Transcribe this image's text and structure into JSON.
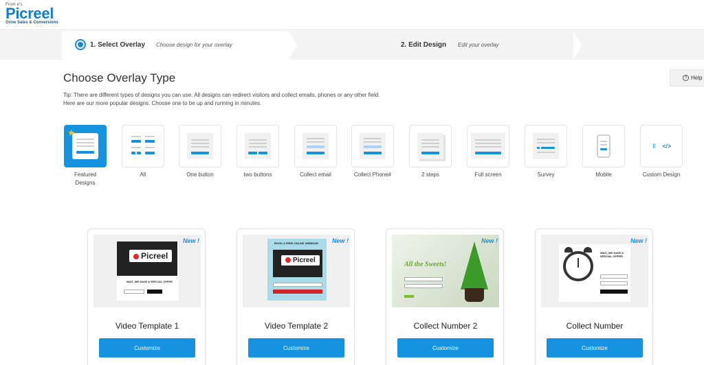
{
  "app": {
    "logo_from": "From e's",
    "brand": "Picreel",
    "tagline": "Grow Sales & Conversions"
  },
  "steps": [
    {
      "title": "1. Select Overlay",
      "subtitle": "Choose design for your overlay"
    },
    {
      "title": "2. Edit Design",
      "subtitle": "Edit your overlay"
    }
  ],
  "page": {
    "title": "Choose Overlay Type",
    "help_label": "Help",
    "tip_line1": "Tip: There are different types of designs you can use. All designs can redirect visitors and collect emails, phones or any other field.",
    "tip_line2": "Here are our more popular designs. Choose one to be up and running in minutes."
  },
  "overlay_types": [
    {
      "label": "Featured Designs",
      "icon": "featured-icon",
      "active": true
    },
    {
      "label": "All",
      "icon": "all-designs-icon"
    },
    {
      "label": "One button",
      "icon": "one-button-icon"
    },
    {
      "label": "two buttons",
      "icon": "two-buttons-icon"
    },
    {
      "label": "Collect email",
      "icon": "collect-email-icon"
    },
    {
      "label": "Collect Phone#",
      "icon": "collect-phone-icon"
    },
    {
      "label": "2 steps",
      "icon": "two-steps-icon"
    },
    {
      "label": "Full screen",
      "icon": "full-screen-icon"
    },
    {
      "label": "Survey",
      "icon": "survey-icon"
    },
    {
      "label": "Mobile",
      "icon": "mobile-icon"
    },
    {
      "label": "Custom Design",
      "icon": "custom-design-icon"
    }
  ],
  "templates": [
    {
      "name": "Video Template 1",
      "badge": "New !",
      "button": "Customize",
      "preview_logo": "Picreel",
      "preview_text": "WAIT, WE HAVE A SPECIAL OFFER"
    },
    {
      "name": "Video Template 2",
      "badge": "New !",
      "button": "Customize",
      "preview_logo": "Picreel",
      "preview_text": "BOOK A FREE ONLINE WEBINAR"
    },
    {
      "name": "Collect Number 2",
      "badge": "New !",
      "button": "Customize",
      "preview_text": "All the Sweets!"
    },
    {
      "name": "Collect Number",
      "badge": "New !",
      "button": "Customize",
      "preview_text": "WAIT, WE HAVE A SPECIAL OFFER!"
    }
  ],
  "colors": {
    "accent": "#1592e0",
    "brand": "#0e7fd6"
  }
}
